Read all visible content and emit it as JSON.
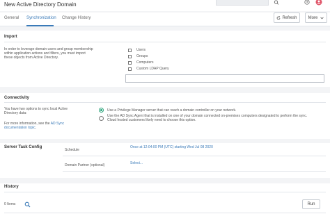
{
  "header": {
    "title": "New Active Directory Domain"
  },
  "tabs": [
    {
      "label": "General",
      "active": false
    },
    {
      "label": "Synchronization",
      "active": true
    },
    {
      "label": "Change History",
      "active": false
    }
  ],
  "actions": {
    "refresh_label": "Refresh",
    "more_label": "More"
  },
  "import": {
    "title": "Import",
    "description_lines": [
      "In order to leverage domain users and group membership",
      "within application actions and filters, you must import",
      "these objects from Active Directory."
    ],
    "options": [
      {
        "label": "Users",
        "checked": false
      },
      {
        "label": "Groups",
        "checked": false
      },
      {
        "label": "Computers",
        "checked": false
      },
      {
        "label": "Custom LDAP Query",
        "checked": false
      }
    ],
    "ldap_value": ""
  },
  "connectivity": {
    "title": "Connectivity",
    "description_lines": [
      "You have two options to sync local Active",
      "Directory data:"
    ],
    "more_info_text": "For more information, see the",
    "more_info_link_1": "AD Sync",
    "more_info_link_2": "documentation topic",
    "more_info_end": ".",
    "options": [
      {
        "lines": [
          "Use a Privilege Manager server that can reach a domain controller on your network."
        ],
        "selected": true
      },
      {
        "lines": [
          "Use the AD Sync Agent that is installed on one of your domain connected on-premises computers designated to perform the sync.",
          "Cloud hosted customers likely need to choose this option."
        ],
        "selected": false
      }
    ]
  },
  "server_task": {
    "title": "Server Task Config",
    "schedule_label": "Schedule",
    "schedule_value": "Once at 12:04:00 PM (UTC) starting Wed Jul 08 2020",
    "partner_label": "Domain Partner (optional)",
    "partner_value": "Select..."
  },
  "history": {
    "title": "History",
    "items_count": "0 Items",
    "run_label": "Run"
  },
  "colors": {
    "accent": "#3a7ab8",
    "radio_selected": "#29a37a",
    "background": "#f3f4f6"
  }
}
